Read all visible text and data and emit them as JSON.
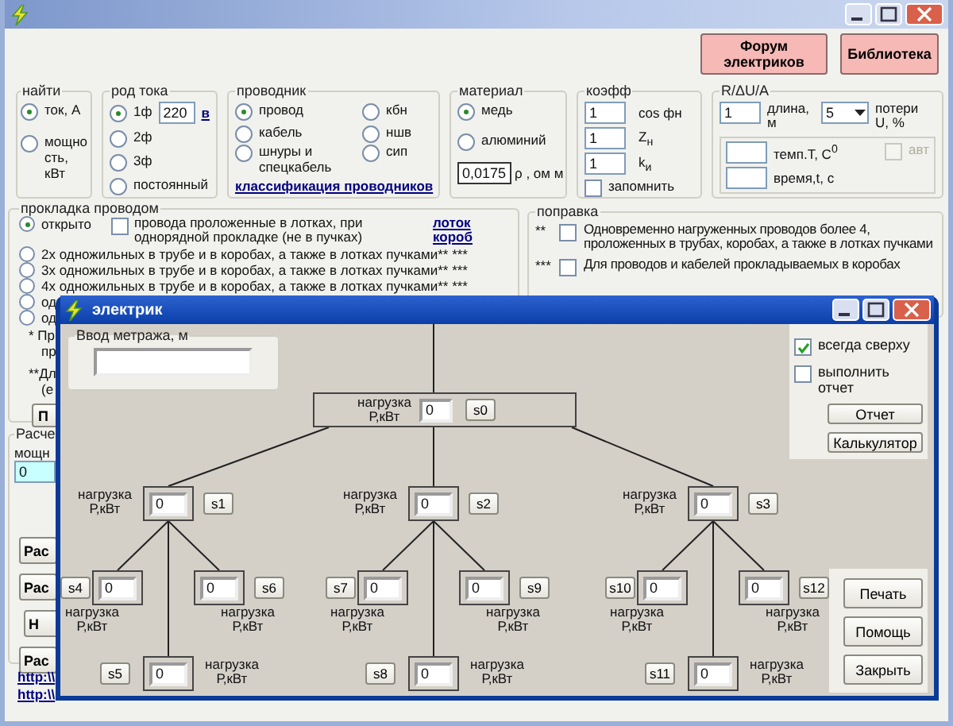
{
  "main_window": {
    "top_buttons": [
      {
        "label": "Форум электриков"
      },
      {
        "label": "Библиотека"
      }
    ],
    "find": {
      "title": "найти",
      "options": [
        {
          "label": "ток, А",
          "selected": true
        },
        {
          "label": "мощно сть, кВт",
          "selected": false
        }
      ]
    },
    "current_type": {
      "title": "род тока",
      "options": [
        {
          "label": "1ф",
          "selected": true
        },
        {
          "label": "2ф",
          "selected": false
        },
        {
          "label": "3ф",
          "selected": false
        },
        {
          "label": "постоянный",
          "selected": false
        }
      ],
      "voltage": "220",
      "voltage_unit": "в"
    },
    "conductor": {
      "title": "проводник",
      "options": [
        {
          "label": "провод",
          "selected": true
        },
        {
          "label": "кабель",
          "selected": false
        },
        {
          "label": "шнуры и спецкабель",
          "selected": false
        },
        {
          "label": "кбн",
          "selected": false
        },
        {
          "label": "ншв",
          "selected": false
        },
        {
          "label": "сип",
          "selected": false
        }
      ],
      "link": "классификация проводников"
    },
    "material": {
      "title": "материал",
      "options": [
        {
          "label": "медь",
          "selected": true
        },
        {
          "label": "алюминий",
          "selected": false
        }
      ],
      "resistivity": "0,0175",
      "resistivity_unit": "ρ , ом м"
    },
    "coefficients": {
      "title": "коэфф",
      "fields": [
        {
          "value": "1",
          "label": "cos фн"
        },
        {
          "value": "1",
          "label": "Z$_{н}$"
        },
        {
          "value": "1",
          "label": "k$_{и}$"
        }
      ],
      "remember": {
        "label": "запомнить",
        "checked": false
      }
    },
    "r_du_a": {
      "title": "R/ΔU/A",
      "length": {
        "value": "1",
        "label": "длина, м"
      },
      "losses": {
        "value": "5",
        "label": "потери U, %"
      },
      "temperature": {
        "label": "темп.T, C$^{0}$"
      },
      "time": {
        "label": "время,t, с"
      },
      "auto": {
        "label": "авт",
        "checked": false,
        "disabled": true
      }
    },
    "laying": {
      "title": "прокладка проводом",
      "options": [
        {
          "label": "открыто",
          "selected": true
        },
        {
          "label": "2х одножильных в трубе и в коробах, а также в лотках пучками** ***",
          "selected": false
        },
        {
          "label": "3х одножильных в трубе и в коробах, а также в лотках пучками** ***",
          "selected": false
        },
        {
          "label": "4х одножильных в трубе и в коробах, а также в лотках пучками** ***",
          "selected": false
        },
        {
          "label": "од",
          "selected": false
        },
        {
          "label": "од",
          "selected": false
        }
      ],
      "tray_check": {
        "label": "провода проложенные в лотках, при однорядной прокладке (не в пучках)",
        "checked": false
      },
      "links": [
        "лоток",
        "короб"
      ],
      "notes": [
        "* Пр",
        "пр",
        "**Дл",
        "(е"
      ],
      "button": "П"
    },
    "correction": {
      "title": "поправка",
      "items": [
        {
          "mark": "**",
          "label": "Одновременно нагруженных проводов более 4, проложенных в трубах, коробах, а также в лотках пучками",
          "checked": false
        },
        {
          "mark": "***",
          "label": "Для проводов и кабелей прокладываемых в коробах",
          "checked": false
        }
      ]
    },
    "calc": {
      "title": "Расче",
      "label": "мощн",
      "value": "0",
      "buttons": [
        "Рас",
        "Рас",
        "Н",
        "Рас"
      ]
    },
    "links": [
      "http:\\\\",
      "http:\\\\"
    ]
  },
  "dialog": {
    "title": "электрик",
    "meter": {
      "title": "Ввод метража, м"
    },
    "always_on_top": {
      "label": "всегда сверху",
      "checked": true
    },
    "report_check": {
      "label": "выполнить отчет",
      "checked": false
    },
    "top_buttons": [
      "Отчет",
      "Калькулятор"
    ],
    "bottom_buttons": [
      "Печать",
      "Помощь",
      "Закрыть"
    ],
    "tree": {
      "label": "нагрузка Р,кВт",
      "value": "0",
      "button": "s0",
      "children": [
        {
          "label": "нагрузка Р,кВт",
          "value": "0",
          "button": "s1",
          "children": [
            {
              "label": "нагрузка Р,кВт",
              "value": "0",
              "button": "s4"
            },
            {
              "label": "нагрузка Р,кВт",
              "value": "0",
              "button": "s6"
            },
            {
              "label": "нагрузка Р,кВт",
              "value": "0",
              "button": "s5"
            }
          ]
        },
        {
          "label": "нагрузка Р,кВт",
          "value": "0",
          "button": "s2",
          "children": [
            {
              "label": "нагрузка Р,кВт",
              "value": "0",
              "button": "s7"
            },
            {
              "label": "нагрузка Р,кВт",
              "value": "0",
              "button": "s9"
            },
            {
              "label": "нагрузка Р,кВт",
              "value": "0",
              "button": "s8"
            }
          ]
        },
        {
          "label": "нагрузка Р,кВт",
          "value": "0",
          "button": "s3",
          "children": [
            {
              "label": "нагрузка Р,кВт",
              "value": "0",
              "button": "s10"
            },
            {
              "label": "нагрузка Р,кВт",
              "value": "0",
              "button": "s12"
            },
            {
              "label": "нагрузка Р,кВт",
              "value": "0",
              "button": "s11"
            }
          ]
        }
      ]
    }
  }
}
